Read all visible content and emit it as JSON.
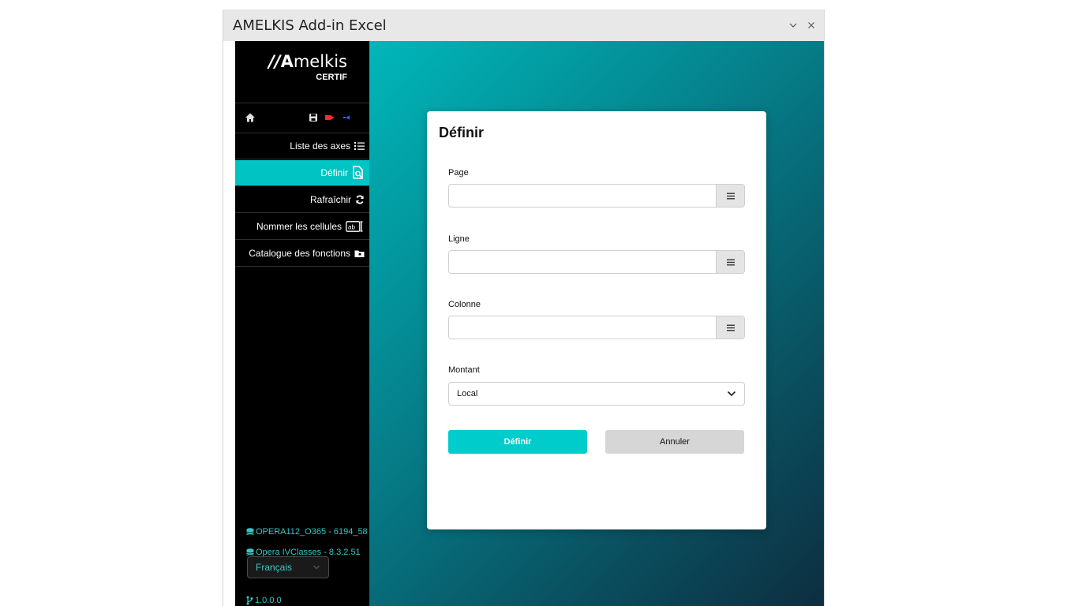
{
  "window": {
    "title": "AMELKIS Add-in Excel"
  },
  "brand": {
    "logo_mark": "//",
    "logo_bold": "A",
    "logo_rest": "melkis",
    "subtitle": "CERTIF"
  },
  "sidebar": {
    "items": [
      {
        "label": "Liste des axes",
        "icon": "list-icon"
      },
      {
        "label": "Définir",
        "icon": "search-document-icon",
        "active": true
      },
      {
        "label": "Rafraîchir",
        "icon": "refresh-icon"
      },
      {
        "label": "Nommer les cellules",
        "icon": "text-field-icon"
      },
      {
        "label": "Catalogue des fonctions",
        "icon": "folder-icon"
      }
    ],
    "env": [
      "OPERA112_O365 - 6194_58",
      "Opera IVClasses - 8.3.2.51"
    ],
    "language": "Français",
    "version": "1.0.0.0"
  },
  "dialog": {
    "title": "Définir",
    "fields": [
      {
        "label": "Page",
        "value": ""
      },
      {
        "label": "Ligne",
        "value": ""
      },
      {
        "label": "Colonne",
        "value": ""
      }
    ],
    "montant": {
      "label": "Montant",
      "selected": "Local"
    },
    "buttons": {
      "confirm": "Définir",
      "cancel": "Annuler"
    }
  },
  "colors": {
    "accent": "#00c4c4",
    "sidebar_bg": "#000000",
    "env_text": "#35c7c7"
  }
}
